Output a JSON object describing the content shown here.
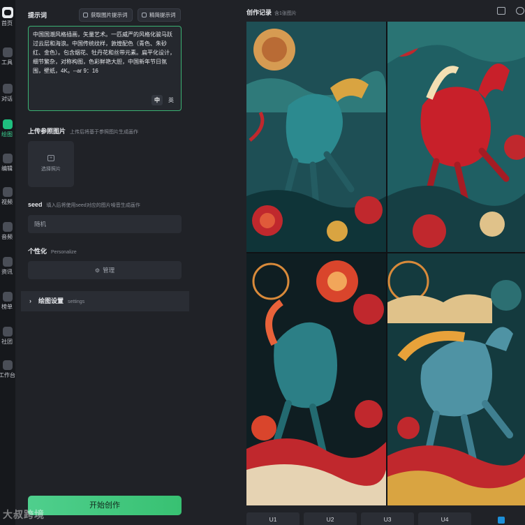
{
  "nav": {
    "items": [
      {
        "label": "首页",
        "icon": "home-icon"
      },
      {
        "label": "工具",
        "icon": "tools-icon"
      },
      {
        "label": "对话",
        "icon": "chat-icon"
      },
      {
        "label": "绘图",
        "icon": "draw-icon"
      },
      {
        "label": "编辑",
        "icon": "edit-icon"
      },
      {
        "label": "视频",
        "icon": "video-icon"
      },
      {
        "label": "音频",
        "icon": "audio-icon"
      },
      {
        "label": "资讯",
        "icon": "news-icon"
      },
      {
        "label": "榜单",
        "icon": "ranking-icon"
      },
      {
        "label": "社团",
        "icon": "community-icon"
      },
      {
        "label": "工作台",
        "icon": "workbench-icon"
      }
    ],
    "active": "绘图"
  },
  "prompt": {
    "label": "提示词",
    "get_image_prompt_btn": "获取图片提示词",
    "optimize_btn": "精简提示词",
    "text": "中国国潮风格插画，矢量艺术。一匹威严的风格化骏马跃过云层和海浪。中国传统纹样，敦煌配色（青色、朱砂红、金色）。包含烟花、牡丹花和丝带元素。扁平化设计，细节繁杂，对称构图，色彩鲜艳大胆，中国新年节日氛围，壁纸，4K。--ar 9：16",
    "lang_zh": "中",
    "lang_en": "英"
  },
  "upload": {
    "label": "上传参照图片",
    "hint": "上传后将基于参照图片生成画作",
    "select_label": "选择照片"
  },
  "seed": {
    "label": "seed",
    "hint": "填入后将使用seed对应的图片噪音生成画作",
    "placeholder": "随机"
  },
  "personalize": {
    "label": "个性化",
    "hint": "Personalize",
    "manage_btn": "管理"
  },
  "settings": {
    "label": "绘图设置",
    "hint": "settings"
  },
  "start_btn": "开始创作",
  "watermark": "大叔跨境",
  "gallery": {
    "title": "创作记录",
    "subtitle": "含1张图片",
    "upscale_buttons": [
      "U1",
      "U2",
      "U3",
      "U4"
    ]
  },
  "colors": {
    "accent": "#3ddc97",
    "teal": "#1f5f63",
    "cinnabar": "#c0282d",
    "gold": "#d9a441"
  }
}
